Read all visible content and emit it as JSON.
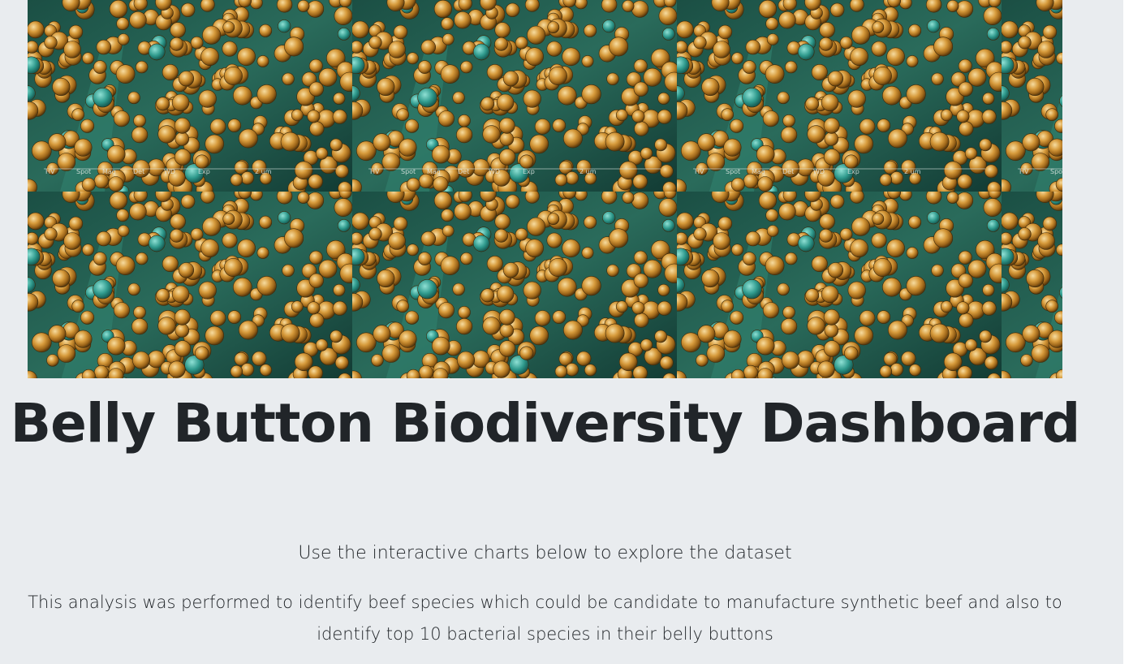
{
  "header": {
    "banner_alt": "bacteria micrograph banner",
    "banner_scale_labels": [
      "HV",
      "Spot",
      "Mag",
      "Det",
      "WD",
      "Exp",
      "2 um"
    ],
    "title": "Belly Button Biodiversity Dashboard",
    "lead": "Use the interactive charts below to explore the dataset",
    "description": "This analysis was performed to identify beef species which could be candidate to manufacture synthetic beef and also to identify top 10 bacterial species in their belly buttons"
  },
  "colors": {
    "jumbotron_bg": "#e9ecef",
    "text": "#212529",
    "micrograph_background": "#1f5a4b",
    "bacteria_gold": "#c98a2b",
    "bacteria_highlight": "#f1d08a",
    "bacteria_teal": "#3aa39a"
  }
}
